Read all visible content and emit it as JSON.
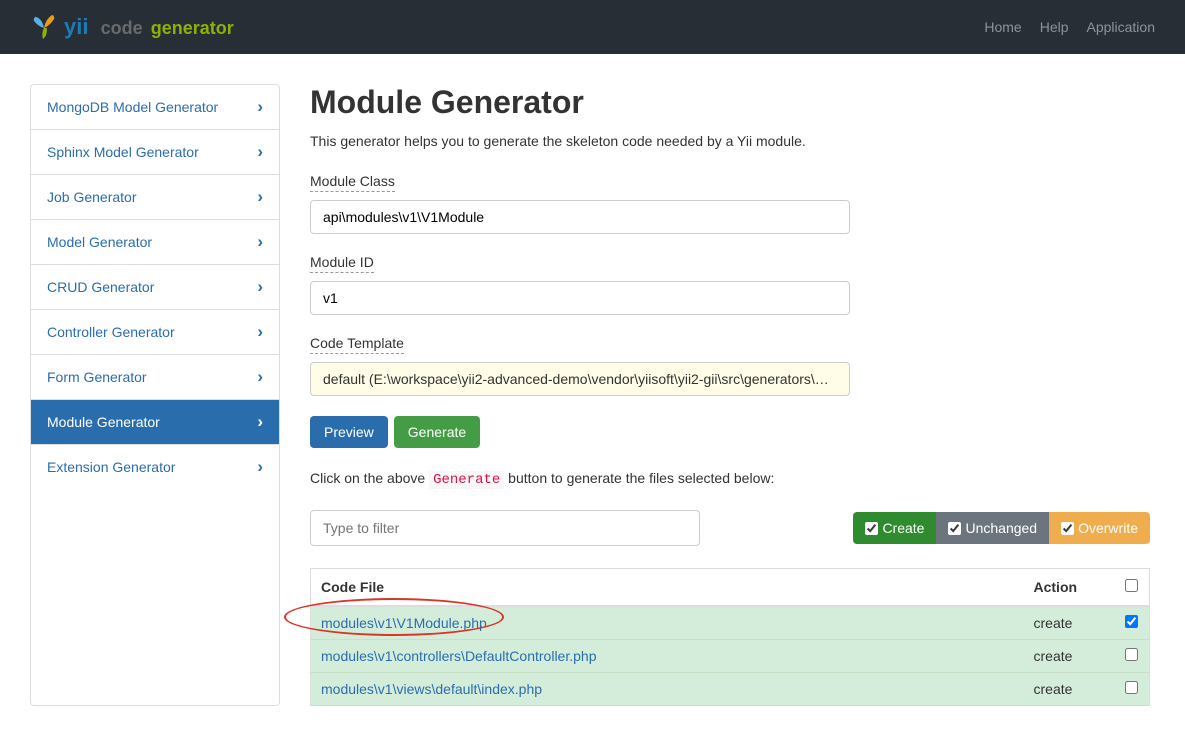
{
  "brand": {
    "yii": "yii",
    "code": "code",
    "generator": "generator"
  },
  "nav": {
    "home": "Home",
    "help": "Help",
    "application": "Application"
  },
  "sidebar": {
    "items": [
      {
        "label": "MongoDB Model Generator"
      },
      {
        "label": "Sphinx Model Generator"
      },
      {
        "label": "Job Generator"
      },
      {
        "label": "Model Generator"
      },
      {
        "label": "CRUD Generator"
      },
      {
        "label": "Controller Generator"
      },
      {
        "label": "Form Generator"
      },
      {
        "label": "Module Generator"
      },
      {
        "label": "Extension Generator"
      }
    ]
  },
  "main": {
    "title": "Module Generator",
    "description": "This generator helps you to generate the skeleton code needed by a Yii module.",
    "module_class_label": "Module Class",
    "module_class_value": "api\\modules\\v1\\V1Module",
    "module_id_label": "Module ID",
    "module_id_value": "v1",
    "code_template_label": "Code Template",
    "code_template_value": "default (E:\\workspace\\yii2-advanced-demo\\vendor\\yiisoft\\yii2-gii\\src\\generators\\mo…",
    "preview_btn": "Preview",
    "generate_btn": "Generate",
    "hint_pre": "Click on the above ",
    "hint_code": "Generate",
    "hint_post": " button to generate the files selected below:",
    "filter_placeholder": "Type to filter",
    "toggle_create": "Create",
    "toggle_unchanged": "Unchanged",
    "toggle_overwrite": "Overwrite",
    "col_file": "Code File",
    "col_action": "Action",
    "files": [
      {
        "path": "modules\\v1\\V1Module.php",
        "action": "create",
        "checked": true
      },
      {
        "path": "modules\\v1\\controllers\\DefaultController.php",
        "action": "create",
        "checked": false
      },
      {
        "path": "modules\\v1\\views\\default\\index.php",
        "action": "create",
        "checked": false
      }
    ]
  }
}
